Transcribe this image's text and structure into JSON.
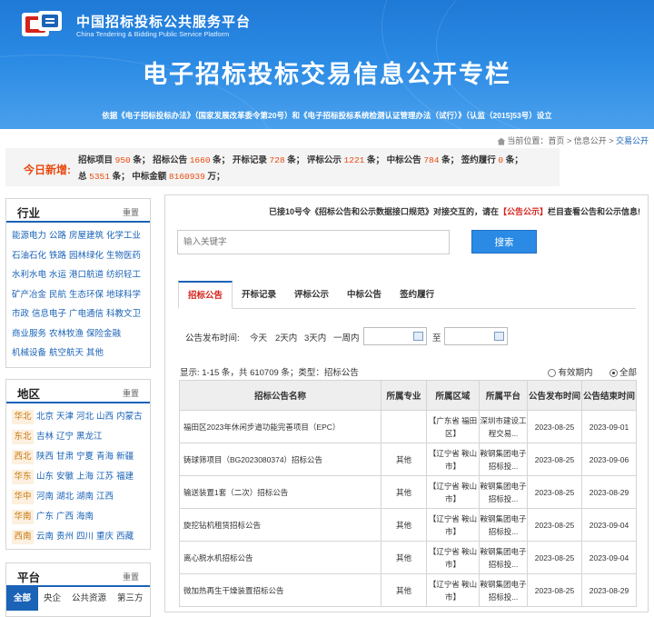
{
  "header": {
    "site_name": "中国招标投标公共服务平台",
    "site_name_en": "China Tendering & Bidding Public Service Platform",
    "title": "电子招标投标交易信息公开专栏",
    "note": "依据《电子招标投标办法》（国家发展改革委令第20号）和《电子招标投标系统检测认证管理办法（试行）》（认监（2015]53号）设立"
  },
  "breadcrumb": {
    "prefix": "当前位置：",
    "home": "首页",
    "sep1": " > ",
    "level2": "信息公开",
    "sep2": " > ",
    "current": "交易公开"
  },
  "today": {
    "label": "今日新增:",
    "i1": "招标项目",
    "v1": "950",
    "u1": "条；",
    "i2": "招标公告",
    "v2": "1660",
    "u2": "条；",
    "i3": "开标记录",
    "v3": "728",
    "u3": "条；",
    "i4": "评标公示",
    "v4": "1221",
    "u4": "条；",
    "i5": "中标公告",
    "v5": "784",
    "u5": "条；",
    "i6": "签约履行",
    "v6": "0",
    "u6": "条；",
    "i7": "总",
    "v7": "5351",
    "u7": "条；",
    "i8": "中标金额",
    "v8": "8160939",
    "u8": "万；"
  },
  "industry": {
    "title": "行业",
    "reset": "重置",
    "items": [
      "能源电力",
      "公路",
      "房屋建筑",
      "化学工业",
      "石油石化",
      "铁路",
      "园林绿化",
      "生物医药",
      "水利水电",
      "水运",
      "港口航道",
      "纺织轻工",
      "矿产冶金",
      "民航",
      "生态环保",
      "地球科学",
      "市政",
      "信息电子",
      "广电通信",
      "科教文卫",
      "商业服务",
      "农林牧渔",
      "保险金融",
      "机械设备",
      "航空航天",
      "其他"
    ]
  },
  "region": {
    "title": "地区",
    "reset": "重置",
    "rows": [
      {
        "prefix": "华北",
        "cities": [
          "北京",
          "天津",
          "河北",
          "山西",
          "内蒙古"
        ]
      },
      {
        "prefix": "东北",
        "cities": [
          "吉林",
          "辽宁",
          "黑龙江"
        ]
      },
      {
        "prefix": "西北",
        "cities": [
          "陕西",
          "甘肃",
          "宁夏",
          "青海",
          "新疆"
        ]
      },
      {
        "prefix": "华东",
        "cities": [
          "山东",
          "安徽",
          "上海",
          "江苏",
          "福建"
        ]
      },
      {
        "prefix": "华中",
        "cities": [
          "河南",
          "湖北",
          "湖南",
          "江西"
        ]
      },
      {
        "prefix": "华南",
        "cities": [
          "广东",
          "广西",
          "海南"
        ]
      },
      {
        "prefix": "西南",
        "cities": [
          "云南",
          "贵州",
          "四川",
          "重庆",
          "西藏"
        ]
      }
    ]
  },
  "platform": {
    "title": "平台",
    "reset": "重置",
    "tabs": [
      "全部",
      "央企",
      "公共资源",
      "第三方"
    ]
  },
  "notice": {
    "a": "已接10号令《招标公告和公示数据接口规范》对接交互的，请在",
    "b": "【公告公示】",
    "c": "栏目查看公告和公示信息!"
  },
  "search": {
    "placeholder": "输入关键字",
    "button": "搜索"
  },
  "tabs": [
    "招标公告",
    "开标记录",
    "评标公示",
    "中标公告",
    "签约履行"
  ],
  "date_filter": {
    "label": "公告发布时间:",
    "opts": [
      "今天",
      "2天内",
      "3天内",
      "一周内"
    ],
    "to": "至"
  },
  "result": {
    "text": "显示:  1-15  条，共  610709  条；类型：招标公告"
  },
  "radio": {
    "a": "有效期内",
    "b": "全部"
  },
  "table": {
    "headers": [
      "招标公告名称",
      "所属专业",
      "所属区域",
      "所属平台",
      "公告发布时间",
      "公告结束时间"
    ],
    "rows": [
      {
        "name": "福田区2023年休闲步道功能完善项目（EPC）",
        "major": "",
        "region": "【广东省 福田区】",
        "platform": "深圳市建设工程交易...",
        "pub": "2023-08-25",
        "end": "2023-09-01"
      },
      {
        "name": "铸球筛项目（BG2023080374）招标公告",
        "major": "其他",
        "region": "【辽宁省 鞍山市】",
        "platform": "鞍钢集团电子招标投...",
        "pub": "2023-08-25",
        "end": "2023-09-06"
      },
      {
        "name": "输送装置1套（二次）招标公告",
        "major": "其他",
        "region": "【辽宁省 鞍山市】",
        "platform": "鞍钢集团电子招标投...",
        "pub": "2023-08-25",
        "end": "2023-08-29"
      },
      {
        "name": "旋挖钻机租赁招标公告",
        "major": "其他",
        "region": "【辽宁省 鞍山市】",
        "platform": "鞍钢集团电子招标投...",
        "pub": "2023-08-25",
        "end": "2023-09-04"
      },
      {
        "name": "离心脱水机招标公告",
        "major": "其他",
        "region": "【辽宁省 鞍山市】",
        "platform": "鞍钢集团电子招标投...",
        "pub": "2023-08-25",
        "end": "2023-09-04"
      },
      {
        "name": "微加热再生干燥装置招标公告",
        "major": "其他",
        "region": "【辽宁省 鞍山市】",
        "platform": "鞍钢集团电子招标投...",
        "pub": "2023-08-25",
        "end": "2023-08-29"
      }
    ]
  }
}
